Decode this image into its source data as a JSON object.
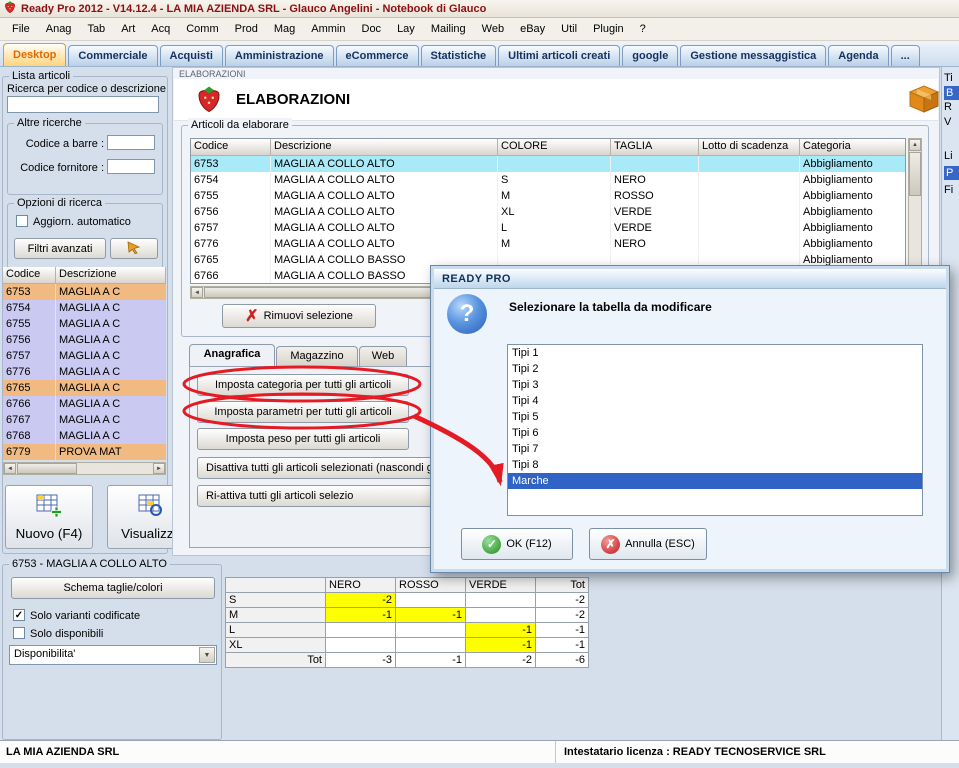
{
  "window": {
    "title": "Ready Pro 2012 - V14.12.4 - LA MIA AZIENDA SRL - Glauco Angelini - Notebook di Glauco"
  },
  "menu": {
    "items": [
      "File",
      "Anag",
      "Tab",
      "Art",
      "Acq",
      "Comm",
      "Prod",
      "Mag",
      "Ammin",
      "Doc",
      "Lay",
      "Mailing",
      "Web",
      "eBay",
      "Util",
      "Plugin",
      "?"
    ]
  },
  "tabbar": {
    "tabs": [
      "Desktop",
      "Commerciale",
      "Acquisti",
      "Amministrazione",
      "eCommerce",
      "Statistiche",
      "Ultimi articoli creati",
      "google",
      "Gestione messaggistica",
      "Agenda",
      "..."
    ],
    "active": "Desktop"
  },
  "sidebar": {
    "caption": "Lista articoli",
    "search_label": "Ricerca per codice o descrizione",
    "search_value": "",
    "altre_caption": "Altre ricerche",
    "barcode_label": "Codice a barre :",
    "barcode_value": "",
    "fornitore_label": "Codice fornitore :",
    "fornitore_value": "",
    "opzioni_caption": "Opzioni di ricerca",
    "aggiorn_label": "Aggiorn. automatico",
    "filtri_label": "Filtri avanzati",
    "table": {
      "headers": [
        "Codice",
        "Descrizione"
      ],
      "rows": [
        {
          "code": "6753",
          "desc": "MAGLIA A C",
          "tint": "#f1ba82"
        },
        {
          "code": "6754",
          "desc": "MAGLIA A C",
          "tint": "#c9c9f2"
        },
        {
          "code": "6755",
          "desc": "MAGLIA A C",
          "tint": "#c9c9f2"
        },
        {
          "code": "6756",
          "desc": "MAGLIA A C",
          "tint": "#c9c9f2"
        },
        {
          "code": "6757",
          "desc": "MAGLIA A C",
          "tint": "#c9c9f2"
        },
        {
          "code": "6776",
          "desc": "MAGLIA A C",
          "tint": "#c9c9f2"
        },
        {
          "code": "6765",
          "desc": "MAGLIA A C",
          "tint": "#f1ba82"
        },
        {
          "code": "6766",
          "desc": "MAGLIA A C",
          "tint": "#c9c9f2"
        },
        {
          "code": "6767",
          "desc": "MAGLIA A C",
          "tint": "#c9c9f2"
        },
        {
          "code": "6768",
          "desc": "MAGLIA A C",
          "tint": "#c9c9f2"
        },
        {
          "code": "6779",
          "desc": "PROVA MAT",
          "tint": "#f1ba82"
        }
      ]
    },
    "nuovo_label": "Nuovo (F4)",
    "visualizza_label": "Visualizza",
    "detail": {
      "caption": "6753 - MAGLIA A COLLO ALTO",
      "schema_label": "Schema taglie/colori",
      "varianti_label": "Solo varianti codificate",
      "varianti_checked": true,
      "disponibili_label": "Solo disponibili",
      "disponibili_checked": false,
      "dispo_value": "Disponibilita'"
    }
  },
  "panel": {
    "caption": "ELABORAZIONI",
    "title": "ELABORAZIONI",
    "group_caption": "Articoli da elaborare",
    "table": {
      "headers": [
        "Codice",
        "Descrizione",
        "COLORE",
        "TAGLIA",
        "Lotto di scadenza",
        "Categoria"
      ],
      "selected_row": 0,
      "rows": [
        [
          "6753",
          "MAGLIA A COLLO ALTO",
          "",
          "",
          "",
          "Abbigliamento"
        ],
        [
          "6754",
          "MAGLIA A COLLO ALTO",
          "S",
          "NERO",
          "",
          "Abbigliamento"
        ],
        [
          "6755",
          "MAGLIA A COLLO ALTO",
          "M",
          "ROSSO",
          "",
          "Abbigliamento"
        ],
        [
          "6756",
          "MAGLIA A COLLO ALTO",
          "XL",
          "VERDE",
          "",
          "Abbigliamento"
        ],
        [
          "6757",
          "MAGLIA A COLLO ALTO",
          "L",
          "VERDE",
          "",
          "Abbigliamento"
        ],
        [
          "6776",
          "MAGLIA A COLLO ALTO",
          "M",
          "NERO",
          "",
          "Abbigliamento"
        ],
        [
          "6765",
          "MAGLIA A COLLO BASSO",
          "",
          "",
          "",
          "Abbigliamento"
        ],
        [
          "6766",
          "MAGLIA A COLLO BASSO",
          "",
          "",
          "",
          ""
        ]
      ]
    },
    "rimuovi_label": "Rimuovi selezione",
    "tabs": [
      "Anagrafica",
      "Magazzino",
      "Web"
    ],
    "active_tab": "Anagrafica",
    "buttons": [
      "Imposta categoria per tutti gli articoli",
      "Imposta parametri per tutti gli articoli",
      "Imposta peso per tutti gli articoli",
      "Disattiva tutti gli articoli selezionati (nascondi gli",
      "Ri-attiva tutti gli articoli selezio"
    ]
  },
  "dialog": {
    "title": "READY PRO",
    "message": "Selezionare la tabella da modificare",
    "items": [
      "Tipi 1",
      "Tipi 2",
      "Tipi 3",
      "Tipi 4",
      "Tipi 5",
      "Tipi 6",
      "Tipi 7",
      "Tipi 8",
      "Marche"
    ],
    "selected_item": "Marche",
    "ok_label": "OK (F12)",
    "cancel_label": "Annulla (ESC)"
  },
  "matrix": {
    "col_headers": [
      "NERO",
      "ROSSO",
      "VERDE",
      "Tot"
    ],
    "rows": [
      {
        "label": "S",
        "cells": [
          {
            "v": "-2",
            "hl": true
          },
          {
            "v": "",
            "hl": false
          },
          {
            "v": "",
            "hl": false
          },
          {
            "v": "-2",
            "hl": false
          }
        ]
      },
      {
        "label": "M",
        "cells": [
          {
            "v": "-1",
            "hl": true
          },
          {
            "v": "-1",
            "hl": true
          },
          {
            "v": "",
            "hl": false
          },
          {
            "v": "-2",
            "hl": false
          }
        ]
      },
      {
        "label": "L",
        "cells": [
          {
            "v": "",
            "hl": false
          },
          {
            "v": "",
            "hl": false
          },
          {
            "v": "-1",
            "hl": true
          },
          {
            "v": "-1",
            "hl": false
          }
        ]
      },
      {
        "label": "XL",
        "cells": [
          {
            "v": "",
            "hl": false
          },
          {
            "v": "",
            "hl": false
          },
          {
            "v": "-1",
            "hl": true
          },
          {
            "v": "-1",
            "hl": false
          }
        ]
      },
      {
        "label": "Tot",
        "cells": [
          {
            "v": "-3",
            "hl": false
          },
          {
            "v": "-1",
            "hl": false
          },
          {
            "v": "-2",
            "hl": false
          },
          {
            "v": "-6",
            "hl": false
          }
        ]
      }
    ]
  },
  "statusbar": {
    "company": "LA MIA AZIENDA SRL",
    "license": "Intestatario licenza : READY TECNOSERVICE SRL"
  },
  "right_strip": {
    "fragments": [
      "Ti",
      "B",
      "R",
      "V",
      "Li",
      "P",
      "Fi"
    ]
  },
  "icons": {
    "question": "?",
    "check": "✓",
    "cross": "✗",
    "remove": "✗",
    "arrow_down": "▼",
    "arrow_up": "▲",
    "arrow_left": "◄",
    "arrow_right": "►"
  },
  "colors": {
    "accent_orange": "#e06a00",
    "selection_cyan": "#a8eaf8",
    "selection_blue": "#2f63c5",
    "row_orange": "#f1ba82",
    "row_lavender": "#c9c9f2",
    "highlight_yellow": "#ffff00",
    "annotation_red": "#e51b24",
    "title_red": "#8c1010"
  }
}
